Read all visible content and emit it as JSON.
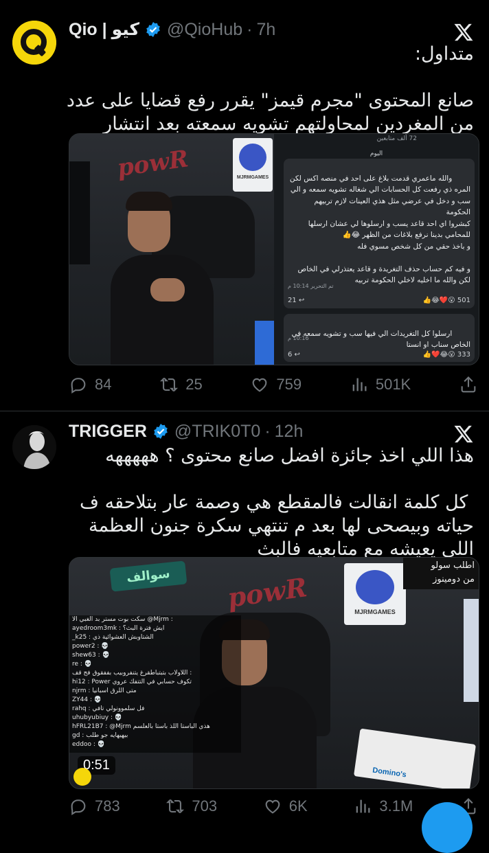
{
  "tweets": [
    {
      "display_name": "Qio | كيو",
      "handle": "@QioHub",
      "time": "7h",
      "text": "متداول:\n\nصانع المحتوى \"مجرم قيمز\" يقرر رفع قضايا على عدد من المغردين لمحاولتهم تشويه سمعته بعد انتشار مقطع له من أحد بثوثه 👀!",
      "media": {
        "chat": {
          "header": "72 ألف متابعين",
          "day_label": "اليوم",
          "msg1": "والله ماعمري قدمت بلاغ على احد في منصه اكس لكن المره ذي رفعت كل الحسابات الي شغاله تشويه سمعه و الي سب و دخل في عرضي مثل هذي العينات لازم تربيهم الحكومة\nكبشروا اي احد قاعد يسب و ارسلوها لي عشان ارسلها للمحامي بدينا نرفع بلاغات من الظهر 😂👍\nو باخذ حقي من كل شخص مسوي فله\n\nو فيه كم حساب حذف التغريدة و قاعد يعتذرلي في الخاص لكن والله ما اخليه لاخلي الحكومة تربيه",
          "msg1_time": "تم التحرير 10:14 م",
          "msg1_reactions": "501",
          "msg1_replies": "21",
          "msg2": "ارسلوا كل التغريدات الي فيها سب و تشويه سمعه في الخاص سناب او انستا",
          "msg2_time": "10:16 م",
          "msg2_reactions": "333",
          "msg2_replies": "6"
        },
        "studio_sign": "MJRMGAMES"
      },
      "replies": "84",
      "reposts": "25",
      "likes": "759",
      "views": "501K"
    },
    {
      "display_name": "TRIGGER",
      "handle": "@TRIK0T0",
      "time": "12h",
      "text": "هذا اللي اخذ جائزة افضل صانع محتوى ؟ هههههه\n\n كل كلمة انقالت فالمقطع هي وصمة عار بتلاحقه ف حياته وبيصحى لها بعد م تنتهي سكرة جنون العظمة اللي يعيشه مع متابعيه فالبث",
      "media": {
        "duration": "0:51",
        "overlay_left": "سوالف",
        "overlay_right_1": "اطلب سولو",
        "overlay_right_2": "من دومينوز",
        "studio_sign": "MJRMGAMES",
        "pizza_brand": "Domino's",
        "chat_lines": [
          "سكت بوت مستر بد الغبي الا @Mjrm :",
          "ayedroom3mk : ايش فترة البث؟",
          "_k25 : الشتاوبش العشوائية ذي",
          "power2 : 💀",
          "shew63 : 💀",
          "re : 💀",
          "اللاولاب بتبتباطقرغ يتنفروبيب بففقوق فج قف :",
          "hi12 : Power تكوف حسابي في التتفك عروي",
          "njrm : متى اللرق اسبانيا",
          "ZY44 : 💀",
          "rahq : فل سلموونولي تافي",
          "uhubyubiuy : 💀",
          "hFRL21B7 : @Mjrm هذي الباستا اللذ باستا بالعلسم",
          "gd : بيهيهايه جو طلب",
          "eddoo : 💀"
        ]
      },
      "replies": "783",
      "reposts": "703",
      "likes": "6K",
      "views": "3.1M"
    }
  ],
  "colors": {
    "background": "#000000",
    "text_primary": "#e7e9ea",
    "text_secondary": "#71767b",
    "verified_blue": "#1d9bf0",
    "divider": "#2f3336",
    "qio_yellow": "#f5d60a"
  },
  "icons": [
    "x-logo-icon",
    "verified-badge-icon",
    "reply-icon",
    "repost-icon",
    "like-icon",
    "views-icon",
    "share-icon"
  ]
}
